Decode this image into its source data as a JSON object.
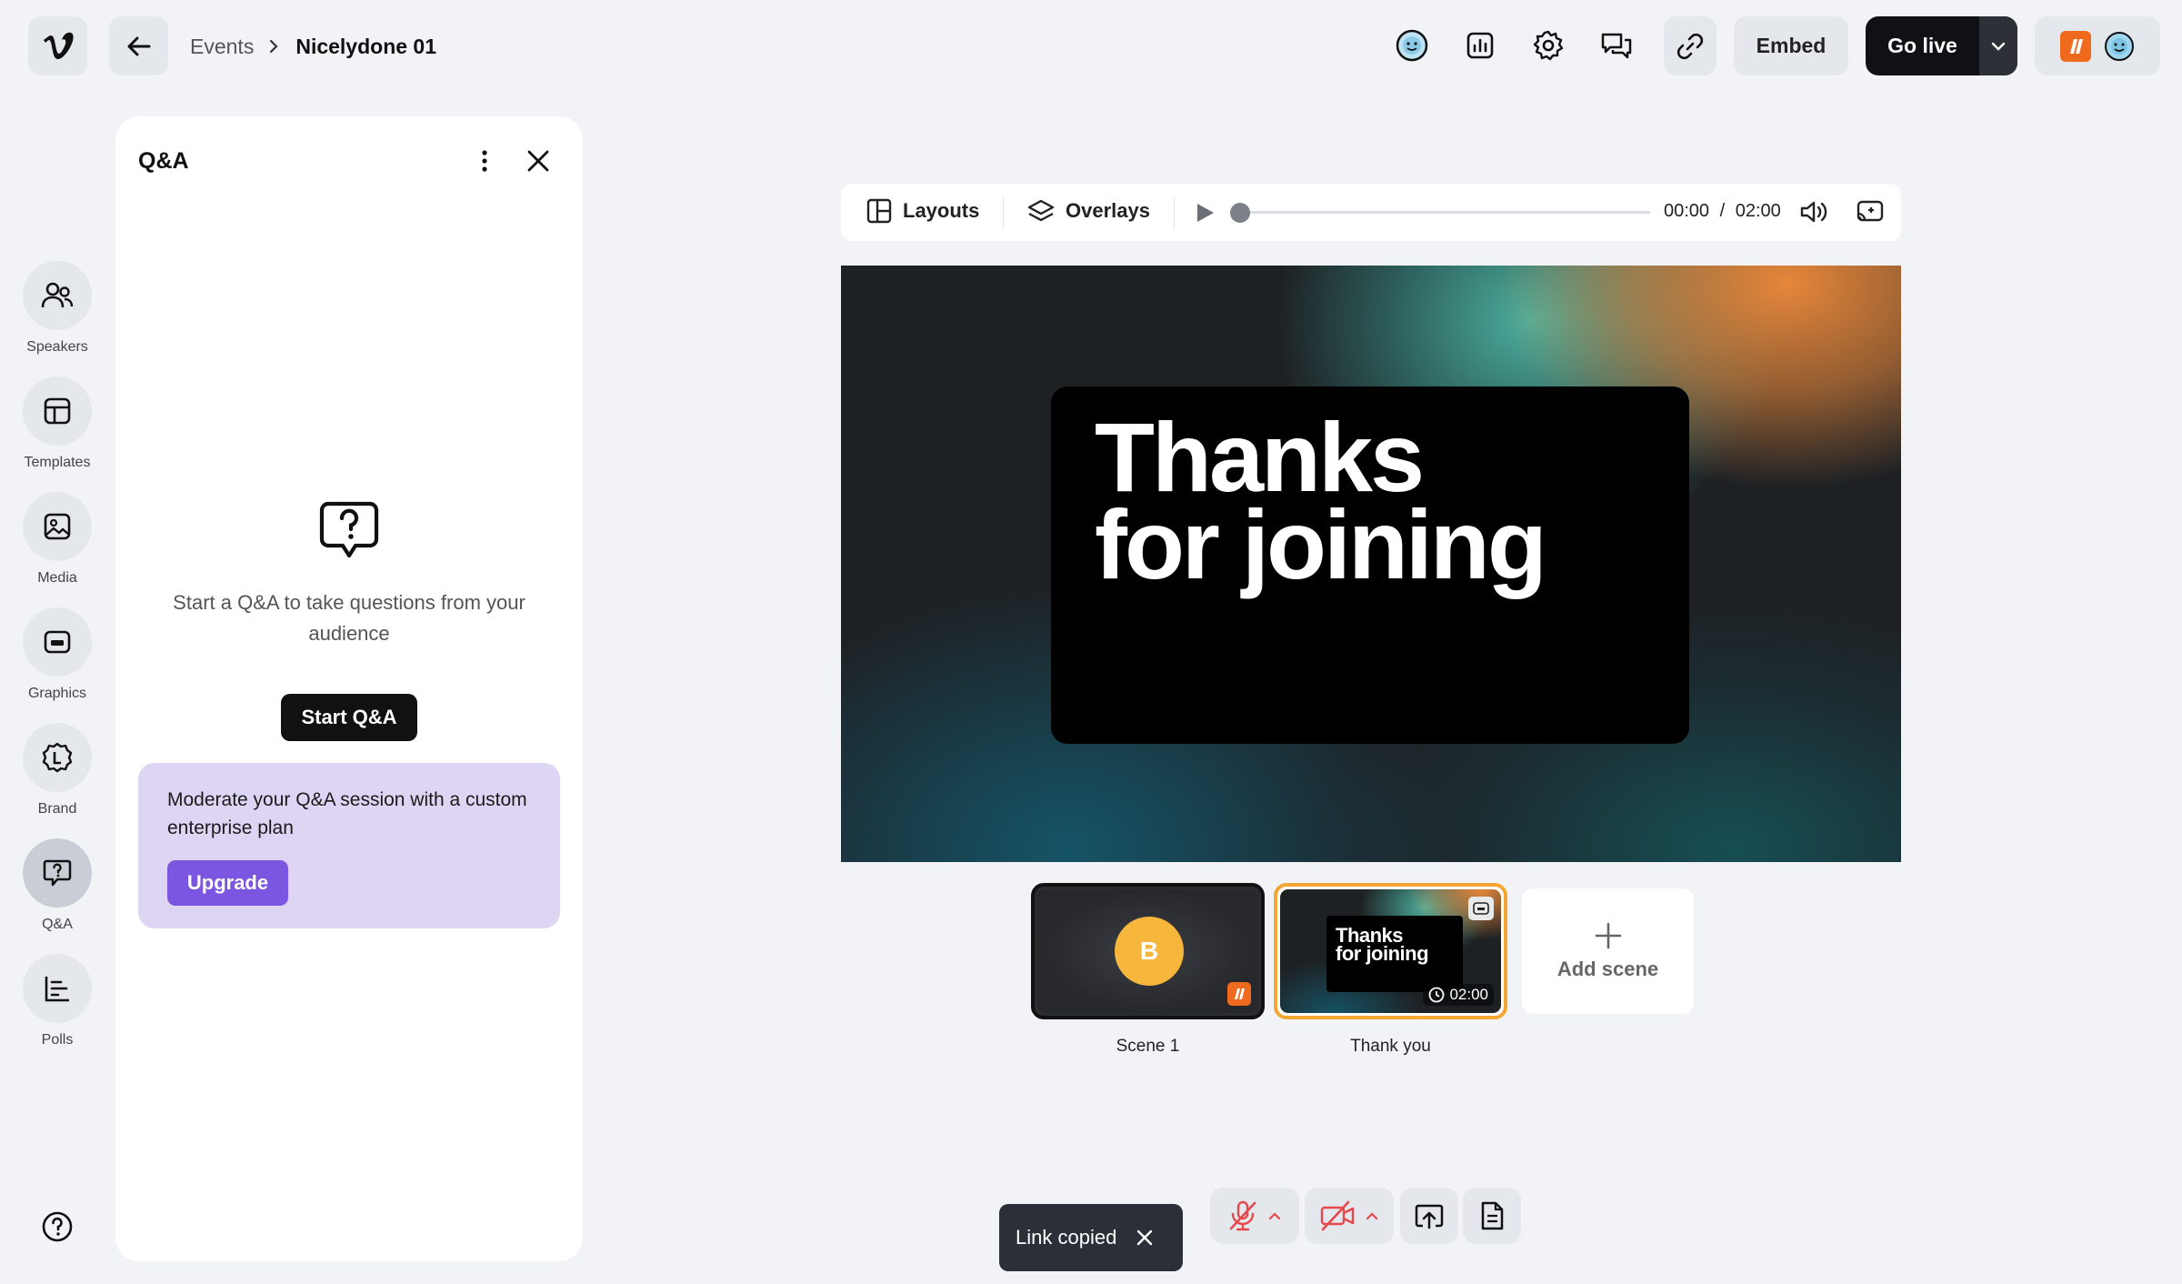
{
  "app": {
    "logo_icon": "vimeo-logo-icon",
    "back_icon": "arrow-left-icon"
  },
  "breadcrumb": {
    "parent": "Events",
    "separator_icon": "chevron-right-icon",
    "current": "Nicelydone 01"
  },
  "header": {
    "icons": [
      "emoji-reaction-icon",
      "analytics-icon",
      "settings-gear-icon",
      "chat-icon",
      "link-icon"
    ],
    "embed_label": "Embed",
    "go_live_label": "Go live",
    "go_live_menu_icon": "chevron-down-icon"
  },
  "sidebar": {
    "items": [
      {
        "label": "Speakers",
        "icon": "speakers-icon"
      },
      {
        "label": "Templates",
        "icon": "templates-icon"
      },
      {
        "label": "Media",
        "icon": "media-icon"
      },
      {
        "label": "Graphics",
        "icon": "graphics-icon"
      },
      {
        "label": "Brand",
        "icon": "brand-icon"
      },
      {
        "label": "Q&A",
        "icon": "qa-icon",
        "active": true
      },
      {
        "label": "Polls",
        "icon": "polls-icon"
      }
    ],
    "help_icon": "help-icon"
  },
  "qa_panel": {
    "title": "Q&A",
    "empty_text": "Start a Q&A to take questions from your audience",
    "start_button": "Start Q&A",
    "upsell_text": "Moderate your Q&A session with a custom enterprise plan",
    "upgrade_button": "Upgrade",
    "accent_color": "#7b56e0",
    "upsell_bg": "#ddd5f3"
  },
  "player": {
    "layouts_label": "Layouts",
    "overlays_label": "Overlays",
    "current_time": "00:00",
    "time_separator": "/",
    "total_time": "02:00",
    "progress": 0
  },
  "stage": {
    "line1": "Thanks",
    "line2": "for joining"
  },
  "scenes": [
    {
      "label": "Scene 1",
      "avatar_letter": "B",
      "selected": true
    },
    {
      "label": "Thank you",
      "thumb_line1": "Thanks",
      "thumb_line2": "for joining",
      "duration": "02:00",
      "live": true
    }
  ],
  "add_scene_label": "Add scene",
  "toast": {
    "text": "Link copied"
  },
  "controls": {
    "mic_icon": "mic-off-icon",
    "camera_icon": "camera-off-icon",
    "share_icon": "share-screen-icon",
    "notes_icon": "notes-icon",
    "muted_color": "#e5484d"
  }
}
